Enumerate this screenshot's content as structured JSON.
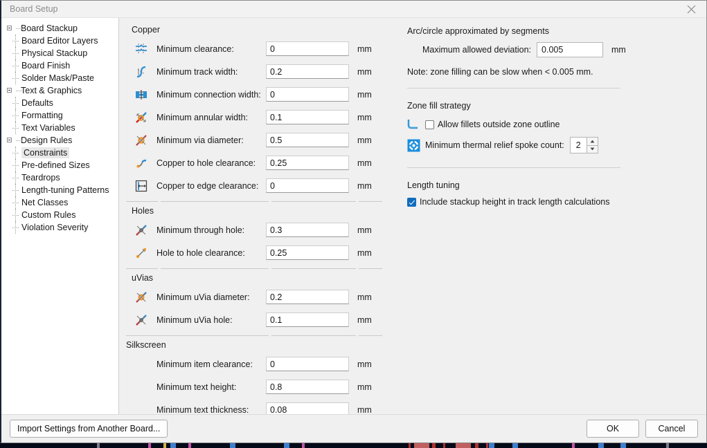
{
  "window": {
    "title": "Board Setup",
    "close_icon": "close-icon"
  },
  "sidebar": {
    "items": [
      {
        "label": "Board Stackup",
        "level": 0,
        "expandable": true,
        "selected": false
      },
      {
        "label": "Board Editor Layers",
        "level": 1,
        "expandable": false,
        "selected": false
      },
      {
        "label": "Physical Stackup",
        "level": 1,
        "expandable": false,
        "selected": false
      },
      {
        "label": "Board Finish",
        "level": 1,
        "expandable": false,
        "selected": false
      },
      {
        "label": "Solder Mask/Paste",
        "level": 1,
        "expandable": false,
        "selected": false
      },
      {
        "label": "Text & Graphics",
        "level": 0,
        "expandable": true,
        "selected": false
      },
      {
        "label": "Defaults",
        "level": 1,
        "expandable": false,
        "selected": false
      },
      {
        "label": "Formatting",
        "level": 1,
        "expandable": false,
        "selected": false
      },
      {
        "label": "Text Variables",
        "level": 1,
        "expandable": false,
        "selected": false
      },
      {
        "label": "Design Rules",
        "level": 0,
        "expandable": true,
        "selected": false
      },
      {
        "label": "Constraints",
        "level": 1,
        "expandable": false,
        "selected": true
      },
      {
        "label": "Pre-defined Sizes",
        "level": 1,
        "expandable": false,
        "selected": false
      },
      {
        "label": "Teardrops",
        "level": 1,
        "expandable": false,
        "selected": false
      },
      {
        "label": "Length-tuning Patterns",
        "level": 1,
        "expandable": false,
        "selected": false
      },
      {
        "label": "Net Classes",
        "level": 1,
        "expandable": false,
        "selected": false
      },
      {
        "label": "Custom Rules",
        "level": 1,
        "expandable": false,
        "selected": false
      },
      {
        "label": "Violation Severity",
        "level": 1,
        "expandable": false,
        "selected": false
      }
    ]
  },
  "constraints": {
    "copper": {
      "title": "Copper",
      "rows": [
        {
          "icon": "min-clearance-icon",
          "label": "Minimum clearance:",
          "value": "0",
          "unit": "mm"
        },
        {
          "icon": "min-track-width-icon",
          "label": "Minimum track width:",
          "value": "0.2",
          "unit": "mm"
        },
        {
          "icon": "min-connection-width-icon",
          "label": "Minimum connection width:",
          "value": "0",
          "unit": "mm"
        },
        {
          "icon": "min-annular-width-icon",
          "label": "Minimum annular width:",
          "value": "0.1",
          "unit": "mm"
        },
        {
          "icon": "min-via-diameter-icon",
          "label": "Minimum via diameter:",
          "value": "0.5",
          "unit": "mm"
        },
        {
          "icon": "copper-to-hole-icon",
          "label": "Copper to hole clearance:",
          "value": "0.25",
          "unit": "mm"
        },
        {
          "icon": "copper-to-edge-icon",
          "label": "Copper to edge clearance:",
          "value": "0",
          "unit": "mm"
        }
      ]
    },
    "holes": {
      "title": "Holes",
      "rows": [
        {
          "icon": "min-through-hole-icon",
          "label": "Minimum through hole:",
          "value": "0.3",
          "unit": "mm"
        },
        {
          "icon": "hole-to-hole-icon",
          "label": "Hole to hole clearance:",
          "value": "0.25",
          "unit": "mm"
        }
      ]
    },
    "uvias": {
      "title": "uVias",
      "rows": [
        {
          "icon": "min-uvia-diameter-icon",
          "label": "Minimum uVia diameter:",
          "value": "0.2",
          "unit": "mm"
        },
        {
          "icon": "min-uvia-hole-icon",
          "label": "Minimum uVia hole:",
          "value": "0.1",
          "unit": "mm"
        }
      ]
    },
    "silkscreen": {
      "title": "Silkscreen",
      "rows": [
        {
          "icon": "",
          "label": "Minimum item clearance:",
          "value": "0",
          "unit": "mm"
        },
        {
          "icon": "",
          "label": "Minimum text height:",
          "value": "0.8",
          "unit": "mm"
        },
        {
          "icon": "",
          "label": "Minimum text thickness:",
          "value": "0.08",
          "unit": "mm"
        }
      ]
    }
  },
  "right_panel": {
    "arc": {
      "title": "Arc/circle approximated by segments",
      "deviation_label": "Maximum allowed deviation:",
      "deviation_value": "0.005",
      "deviation_unit": "mm",
      "note": "Note: zone filling can be slow when < 0.005 mm."
    },
    "zone_fill": {
      "title": "Zone fill strategy",
      "fillets_icon": "fillet-corner-icon",
      "fillets_label": "Allow fillets outside zone outline",
      "fillets_checked": false,
      "spoke_icon": "thermal-relief-icon",
      "spoke_label": "Minimum thermal relief spoke count:",
      "spoke_value": "2"
    },
    "length_tuning": {
      "title": "Length tuning",
      "stackup_label": "Include stackup height in track length calculations",
      "stackup_checked": true
    }
  },
  "footer": {
    "import_label": "Import Settings from Another Board...",
    "ok_label": "OK",
    "cancel_label": "Cancel"
  },
  "colors": {
    "accent": "#0f6cbd",
    "panel_bg": "#f0f0f0",
    "tree_bg": "#ffffff",
    "field_bg": "#ffffff",
    "icon_blue": "#2b8fd4",
    "icon_orange": "#f0941e",
    "icon_red": "#cf2a2a",
    "icon_gray": "#7a7a7a"
  }
}
